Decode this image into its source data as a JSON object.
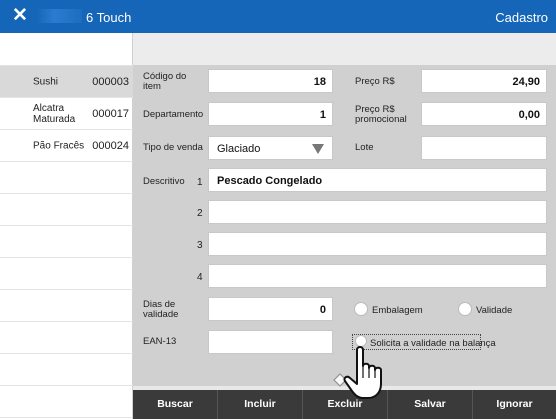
{
  "titlebar": {
    "app_name": "6 Touch",
    "right_title": "Cadastro",
    "close_glyph": "✕"
  },
  "sidebar": {
    "items": [
      {
        "name": "Sushi",
        "code": "000003",
        "selected": true
      },
      {
        "name": "Alcatra Maturada",
        "code": "000017",
        "selected": false
      },
      {
        "name": "Pão Fracês",
        "code": "000024",
        "selected": false
      }
    ]
  },
  "form": {
    "codigo_label": "Código do item",
    "codigo_value": "18",
    "preco_label": "Preço R$",
    "preco_value": "24,90",
    "departamento_label": "Departamento",
    "departamento_value": "1",
    "preco_promo_label": "Preço R$ promocional",
    "preco_promo_value": "0,00",
    "tipo_venda_label": "Tipo de venda",
    "tipo_venda_value": "Glaciado",
    "lote_label": "Lote",
    "lote_value": "",
    "descritivo_label": "Descritivo",
    "descritivo_lines": [
      {
        "num": "1",
        "value": "Pescado Congelado"
      },
      {
        "num": "2",
        "value": ""
      },
      {
        "num": "3",
        "value": ""
      },
      {
        "num": "4",
        "value": ""
      }
    ],
    "dias_validade_label": "Dias de validade",
    "dias_validade_value": "0",
    "radio_embalagem": "Embalagem",
    "radio_validade": "Validade",
    "ean_label": "EAN-13",
    "ean_value": "",
    "solicita_label": "Solicita a validade na balança"
  },
  "footer": {
    "buttons": [
      "Buscar",
      "Incluir",
      "Excluir",
      "Salvar",
      "Ignorar"
    ]
  },
  "colors": {
    "titlebar": "#1565b8",
    "footer": "#3a3a3a",
    "form_bg": "#d0d0d0"
  }
}
